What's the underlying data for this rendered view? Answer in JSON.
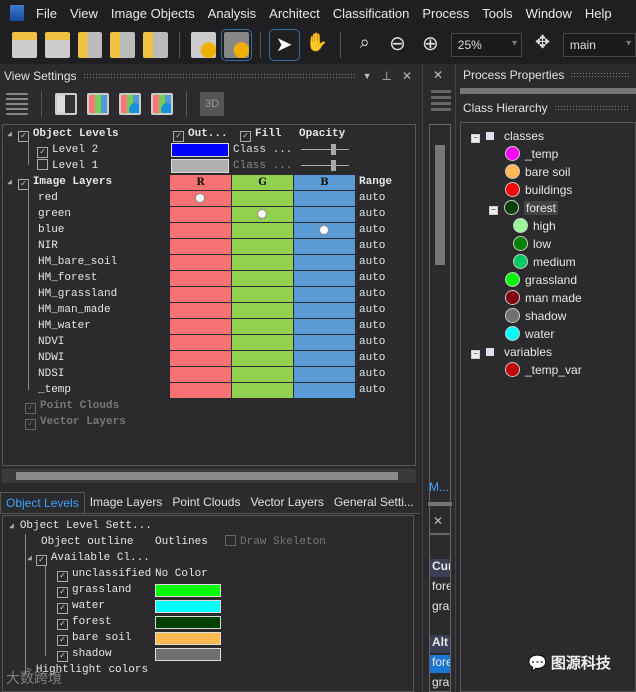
{
  "menu": [
    "File",
    "View",
    "Image Objects",
    "Analysis",
    "Architect",
    "Classification",
    "Process",
    "Tools",
    "Window",
    "Help"
  ],
  "toolbar": {
    "zoom": "25%",
    "map": "main",
    "icons": [
      "add-layer-icon",
      "save-project-icon",
      "add-image-icon",
      "import-icon",
      "open-folder-icon",
      "layers-coin-icon",
      "process-coin-icon",
      "pointer-icon",
      "hand-icon",
      "zoom-area-icon",
      "zoom-out-icon",
      "zoom-in-icon",
      "pan-zoom-icon"
    ]
  },
  "view_settings": {
    "title": "View Settings",
    "three_d": "3D",
    "object_levels": {
      "label": "Object Levels",
      "outline_header": "Out...",
      "fill_header": "Fill",
      "opacity_header": "Opacity",
      "levels": [
        {
          "name": "Level 2",
          "checked": true,
          "color": "#0000ff",
          "fill": "Class ..."
        },
        {
          "name": "Level 1",
          "checked": false,
          "color": "#b0b0b0",
          "fill": "Class ..."
        }
      ]
    },
    "image_layers": {
      "label": "Image Layers",
      "cols": [
        "R",
        "G",
        "B",
        "Range"
      ],
      "layers": [
        {
          "name": "red",
          "sel": "R",
          "range": "auto"
        },
        {
          "name": "green",
          "sel": "G",
          "range": "auto"
        },
        {
          "name": "blue",
          "sel": "B",
          "range": "auto"
        },
        {
          "name": "NIR",
          "range": "auto"
        },
        {
          "name": "HM_bare_soil",
          "range": "auto"
        },
        {
          "name": "HM_forest",
          "range": "auto"
        },
        {
          "name": "HM_grassland",
          "range": "auto"
        },
        {
          "name": "HM_man_made",
          "range": "auto"
        },
        {
          "name": "HM_water",
          "range": "auto"
        },
        {
          "name": "NDVI",
          "range": "auto"
        },
        {
          "name": "NDWI",
          "range": "auto"
        },
        {
          "name": "NDSI",
          "range": "auto"
        },
        {
          "name": "_temp",
          "range": "auto"
        }
      ],
      "colors": {
        "R": "#f77272",
        "G": "#92d050",
        "B": "#5b9bd5"
      }
    },
    "point_clouds": "Point Clouds",
    "vector_layers": "Vector Layers"
  },
  "bottom_tabs": [
    "Object Levels",
    "Image Layers",
    "Point Clouds",
    "Vector Layers",
    "General Setti..."
  ],
  "object_level_settings": {
    "title": "Object Level Sett...",
    "outline_label": "Object outline",
    "outline_value": "Outlines",
    "skeleton": "Draw Skeleton",
    "available": "Available Cl...",
    "classes": [
      {
        "name": "unclassified",
        "value": "No Color"
      },
      {
        "name": "grassland",
        "color": "#00ff00"
      },
      {
        "name": "water",
        "color": "#00ffff"
      },
      {
        "name": "forest",
        "color": "#004000"
      },
      {
        "name": "bare soil",
        "color": "#ffb950"
      },
      {
        "name": "shadow",
        "color": "#707070"
      }
    ],
    "highlight": "Hightlight colors"
  },
  "middle": {
    "tab": "M...",
    "cur": "Cur",
    "cur_items": [
      "fore",
      "gra"
    ],
    "alt": "Alt",
    "alt_items": [
      "fore",
      "gra"
    ]
  },
  "process_properties": {
    "title": "Process Properties"
  },
  "class_hierarchy": {
    "title": "Class Hierarchy",
    "classes": {
      "label": "classes",
      "items": [
        {
          "name": "_temp",
          "color": "#ff00ff"
        },
        {
          "name": "bare soil",
          "color": "#ffb950"
        },
        {
          "name": "buildings",
          "color": "#ff0000"
        },
        {
          "name": "forest",
          "color": "#004000",
          "children": [
            {
              "name": "high",
              "color": "#98fb98"
            },
            {
              "name": "low",
              "color": "#008000"
            },
            {
              "name": "medium",
              "color": "#00c864"
            }
          ]
        },
        {
          "name": "grassland",
          "color": "#00ff00"
        },
        {
          "name": "man made",
          "color": "#800010"
        },
        {
          "name": "shadow",
          "color": "#707070"
        },
        {
          "name": "water",
          "color": "#00ffff"
        }
      ]
    },
    "variables": {
      "label": "variables",
      "items": [
        {
          "name": "_temp_var",
          "color": "#c00000"
        }
      ]
    }
  },
  "watermark": {
    "left": "大数跨境",
    "right": "图源科技"
  }
}
